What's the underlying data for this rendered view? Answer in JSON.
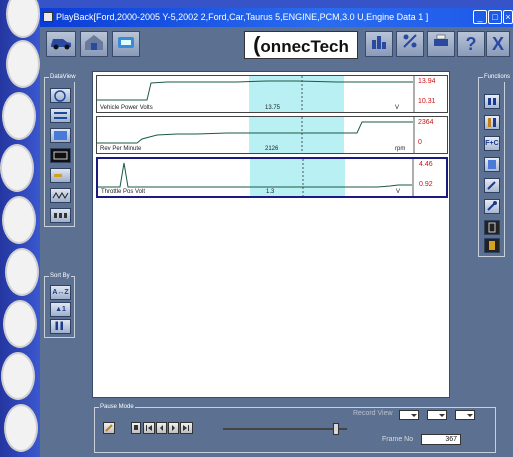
{
  "window": {
    "title": "PlayBack[Ford,2000-2005 Y-5,2002 2,Ford,Car,Taurus 5,ENGINE,PCM,3.0 U,Engine Data 1 ]",
    "minimize_label": "_",
    "maximize_label": "□",
    "close_label": "×"
  },
  "toolbar": {
    "logo_text": "onnecTech",
    "help_label": "?",
    "close_label": "X"
  },
  "dataview": {
    "group_label": "DataView"
  },
  "sortby": {
    "group_label": "Sort By",
    "az_label": "A↔Z",
    "btn2_label": "▲1",
    "btn3_label": "▌▌"
  },
  "functions": {
    "group_label": "Functions",
    "fc_label": "F+C"
  },
  "graphs": [
    {
      "name": "Vehicle Power Volts",
      "value": "13.75",
      "unit": "V",
      "max": "13.94",
      "min": "10.31"
    },
    {
      "name": "Rev Per Minute",
      "value": "2126",
      "unit": "rpm",
      "max": "2364",
      "min": "0"
    },
    {
      "name": "Throttle Pos Volt",
      "value": "1.3",
      "unit": "V",
      "max": "4.46",
      "min": "0.92"
    }
  ],
  "pause": {
    "group_label": "Pause Mode",
    "record_view_label": "Record View",
    "frame_label": "Frame No",
    "frame_value": "367",
    "slider_position": 0.93
  },
  "colors": {
    "title_bar": "#0a3dd6",
    "window_bg": "#5c7191",
    "highlight": "#b8f0f4",
    "trace": "#1a5a40",
    "minmax_text": "#d01010"
  }
}
